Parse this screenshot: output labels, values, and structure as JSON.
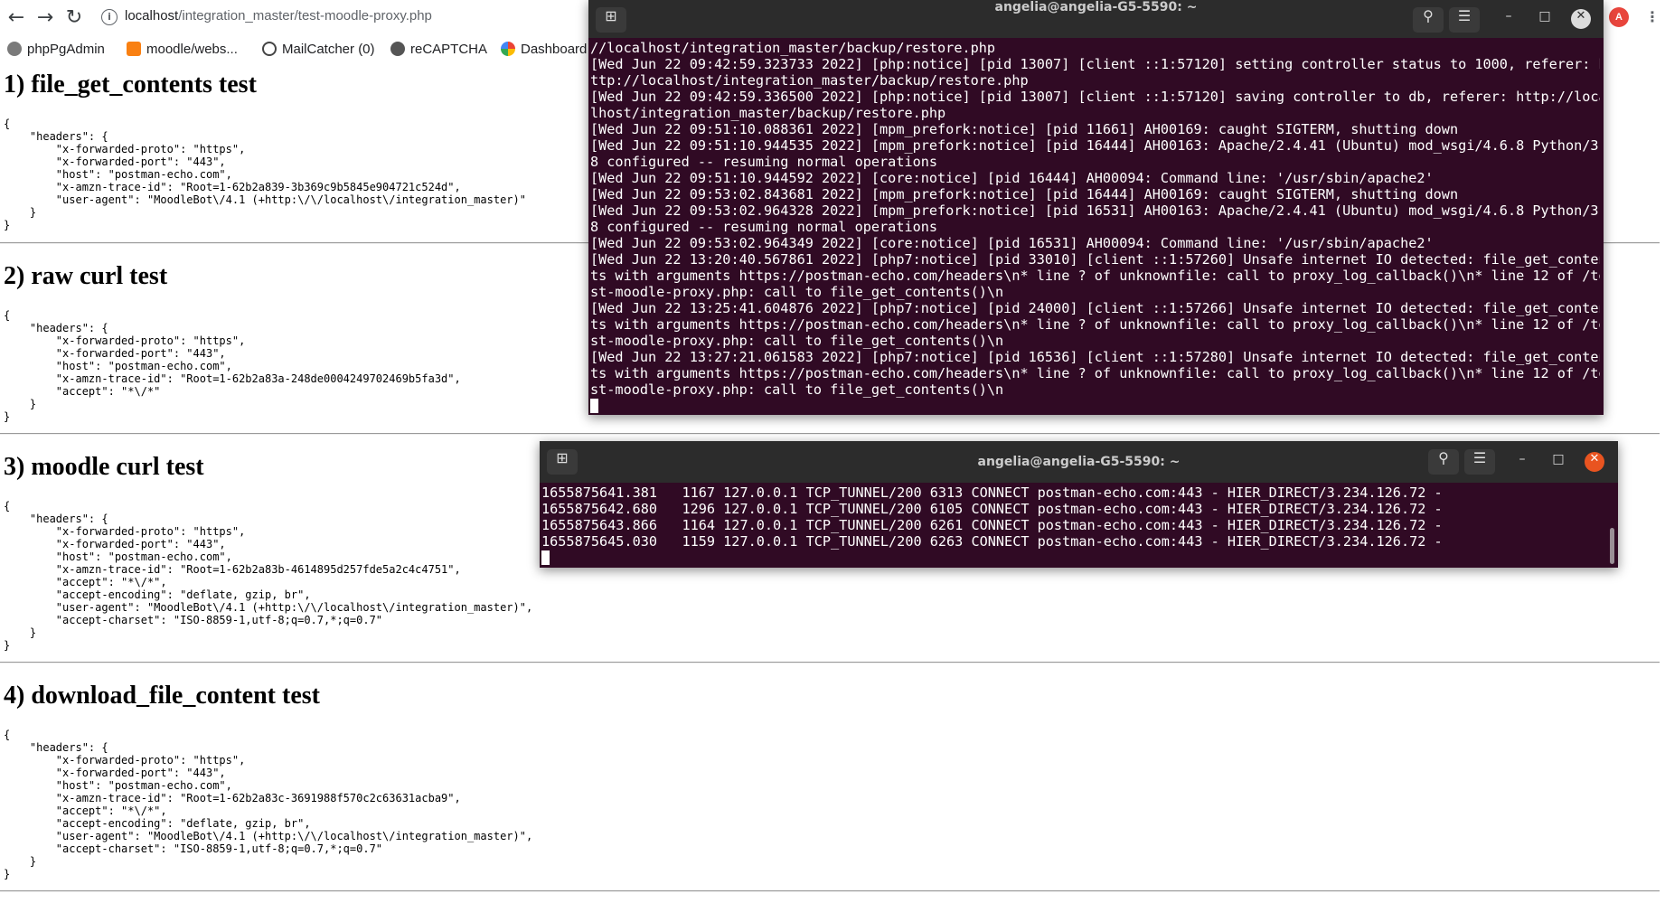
{
  "colors": {
    "terminal_bg": "#300a24",
    "terminal_header": "#2c2c2c",
    "close_button": "#e95420",
    "profile_avatar": "#e8453c"
  },
  "browser": {
    "url_host": "localhost",
    "url_path": "/integration_master/test-moodle-proxy.php",
    "profile_initial": "A",
    "bookmarks": [
      {
        "label": "phpPgAdmin",
        "icon": "elephant-icon"
      },
      {
        "label": "moodle/webs...",
        "icon": "moodle-icon"
      },
      {
        "label": "MailCatcher (0)",
        "icon": "mailcatcher-icon"
      },
      {
        "label": "reCAPTCHA",
        "icon": "recaptcha-icon"
      },
      {
        "label": "Dashboard",
        "icon": "dashboard-icon"
      }
    ]
  },
  "page": {
    "sections": [
      {
        "title": "1) file_get_contents test",
        "body": "{\n    \"headers\": {\n        \"x-forwarded-proto\": \"https\",\n        \"x-forwarded-port\": \"443\",\n        \"host\": \"postman-echo.com\",\n        \"x-amzn-trace-id\": \"Root=1-62b2a839-3b369c9b5845e904721c524d\",\n        \"user-agent\": \"MoodleBot\\/4.1 (+http:\\/\\/localhost\\/integration_master)\"\n    }\n}"
      },
      {
        "title": "2) raw curl test",
        "body": "{\n    \"headers\": {\n        \"x-forwarded-proto\": \"https\",\n        \"x-forwarded-port\": \"443\",\n        \"host\": \"postman-echo.com\",\n        \"x-amzn-trace-id\": \"Root=1-62b2a83a-248de0004249702469b5fa3d\",\n        \"accept\": \"*\\/*\"\n    }\n}"
      },
      {
        "title": "3) moodle curl test",
        "body": "{\n    \"headers\": {\n        \"x-forwarded-proto\": \"https\",\n        \"x-forwarded-port\": \"443\",\n        \"host\": \"postman-echo.com\",\n        \"x-amzn-trace-id\": \"Root=1-62b2a83b-4614895d257fde5a2c4c4751\",\n        \"accept\": \"*\\/*\",\n        \"accept-encoding\": \"deflate, gzip, br\",\n        \"user-agent\": \"MoodleBot\\/4.1 (+http:\\/\\/localhost\\/integration_master)\",\n        \"accept-charset\": \"ISO-8859-1,utf-8;q=0.7,*;q=0.7\"\n    }\n}"
      },
      {
        "title": "4) download_file_content test",
        "body": "{\n    \"headers\": {\n        \"x-forwarded-proto\": \"https\",\n        \"x-forwarded-port\": \"443\",\n        \"host\": \"postman-echo.com\",\n        \"x-amzn-trace-id\": \"Root=1-62b2a83c-3691988f570c2c63631acba9\",\n        \"accept\": \"*\\/*\",\n        \"accept-encoding\": \"deflate, gzip, br\",\n        \"user-agent\": \"MoodleBot\\/4.1 (+http:\\/\\/localhost\\/integration_master)\",\n        \"accept-charset\": \"ISO-8859-1,utf-8;q=0.7,*;q=0.7\"\n    }\n}"
      }
    ]
  },
  "terminal1": {
    "title": "angelia@angelia-G5-5590: ~",
    "lines": [
      "//localhost/integration_master/backup/restore.php",
      "[Wed Jun 22 09:42:59.323733 2022] [php:notice] [pid 13007] [client ::1:57120] setting controller status to 1000, referer: h",
      "ttp://localhost/integration_master/backup/restore.php",
      "[Wed Jun 22 09:42:59.336500 2022] [php:notice] [pid 13007] [client ::1:57120] saving controller to db, referer: http://loca",
      "lhost/integration_master/backup/restore.php",
      "[Wed Jun 22 09:51:10.088361 2022] [mpm_prefork:notice] [pid 11661] AH00169: caught SIGTERM, shutting down",
      "[Wed Jun 22 09:51:10.944535 2022] [mpm_prefork:notice] [pid 16444] AH00163: Apache/2.4.41 (Ubuntu) mod_wsgi/4.6.8 Python/3.",
      "8 configured -- resuming normal operations",
      "[Wed Jun 22 09:51:10.944592 2022] [core:notice] [pid 16444] AH00094: Command line: '/usr/sbin/apache2'",
      "[Wed Jun 22 09:53:02.843681 2022] [mpm_prefork:notice] [pid 16444] AH00169: caught SIGTERM, shutting down",
      "[Wed Jun 22 09:53:02.964328 2022] [mpm_prefork:notice] [pid 16531] AH00163: Apache/2.4.41 (Ubuntu) mod_wsgi/4.6.8 Python/3.",
      "8 configured -- resuming normal operations",
      "[Wed Jun 22 09:53:02.964349 2022] [core:notice] [pid 16531] AH00094: Command line: '/usr/sbin/apache2'",
      "[Wed Jun 22 13:20:40.567861 2022] [php7:notice] [pid 33010] [client ::1:57260] Unsafe internet IO detected: file_get_conten",
      "ts with arguments https://postman-echo.com/headers\\n* line ? of unknownfile: call to proxy_log_callback()\\n* line 12 of /te",
      "st-moodle-proxy.php: call to file_get_contents()\\n",
      "[Wed Jun 22 13:25:41.604876 2022] [php7:notice] [pid 24000] [client ::1:57266] Unsafe internet IO detected: file_get_conten",
      "ts with arguments https://postman-echo.com/headers\\n* line ? of unknownfile: call to proxy_log_callback()\\n* line 12 of /te",
      "st-moodle-proxy.php: call to file_get_contents()\\n",
      "[Wed Jun 22 13:27:21.061583 2022] [php7:notice] [pid 16536] [client ::1:57280] Unsafe internet IO detected: file_get_conten",
      "ts with arguments https://postman-echo.com/headers\\n* line ? of unknownfile: call to proxy_log_callback()\\n* line 12 of /te",
      "st-moodle-proxy.php: call to file_get_contents()\\n"
    ]
  },
  "terminal2": {
    "title": "angelia@angelia-G5-5590: ~",
    "lines": [
      "1655875641.381   1167 127.0.0.1 TCP_TUNNEL/200 6313 CONNECT postman-echo.com:443 - HIER_DIRECT/3.234.126.72 -",
      "1655875642.680   1296 127.0.0.1 TCP_TUNNEL/200 6105 CONNECT postman-echo.com:443 - HIER_DIRECT/3.234.126.72 -",
      "1655875643.866   1164 127.0.0.1 TCP_TUNNEL/200 6261 CONNECT postman-echo.com:443 - HIER_DIRECT/3.234.126.72 -",
      "1655875645.030   1159 127.0.0.1 TCP_TUNNEL/200 6263 CONNECT postman-echo.com:443 - HIER_DIRECT/3.234.126.72 -"
    ]
  }
}
